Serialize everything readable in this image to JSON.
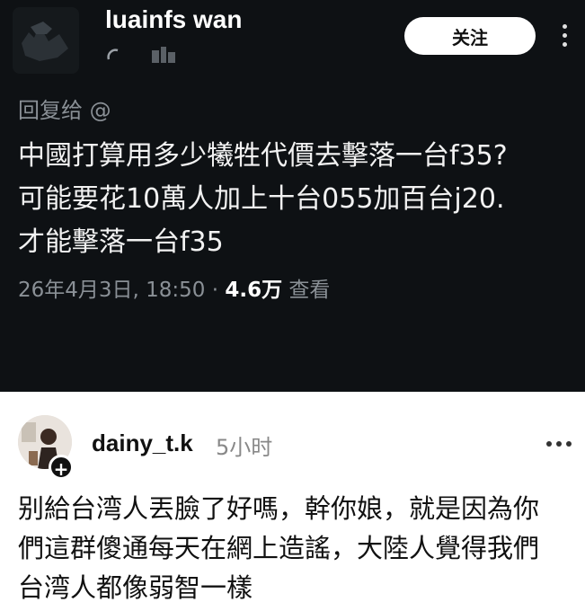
{
  "post": {
    "username": "luainfs wan",
    "follow_label": "关注",
    "reply_to": "回复给 @",
    "text_lines": [
      "中國打算用多少犧牲代價去擊落一台f35?",
      "可能要花10萬人加上十台055加百台j20.",
      "才能擊落一台f35"
    ],
    "datetime": "26年4月3日, 18:50 · ",
    "views": "4.6万",
    "views_suffix": " 查看"
  },
  "comment": {
    "username": "dainy_t.k",
    "time_ago": "5小时",
    "text_lines": [
      "别給台湾人丟臉了好嗎，幹你娘，就是因為你",
      "們這群傻通每天在網上造謠，大陸人覺得我們",
      "台湾人都像弱智一樣"
    ]
  },
  "colors": {
    "dark_bg": "#0e1114",
    "muted_text": "#8a9096",
    "light_bg": "#ffffff"
  },
  "icons": [
    "more-vertical-icon",
    "follow-plus-icon",
    "more-horizontal-icon"
  ]
}
